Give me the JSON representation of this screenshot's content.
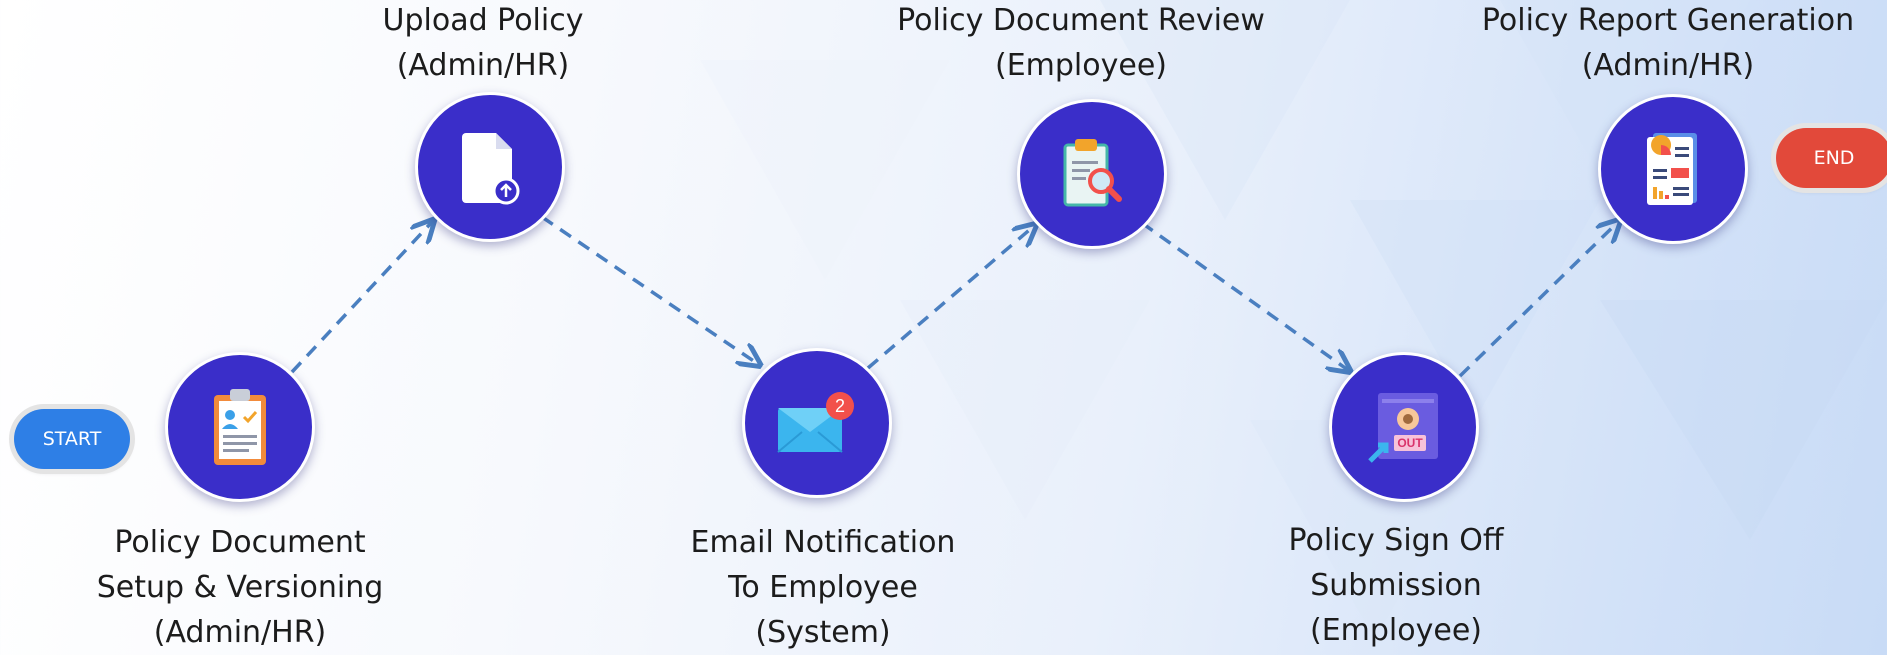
{
  "start_label": "START",
  "end_label": "END",
  "steps": [
    {
      "lines": [
        "Policy Document",
        "Setup & Versioning",
        "(Admin/HR)"
      ],
      "icon": "clipboard-checklist-icon"
    },
    {
      "lines": [
        "Upload Policy",
        "(Admin/HR)"
      ],
      "icon": "document-upload-icon"
    },
    {
      "lines": [
        "Email Notification",
        "To Employee",
        "(System)"
      ],
      "icon": "email-notification-icon",
      "badge": "2"
    },
    {
      "lines": [
        "Policy Document Review",
        "(Employee)"
      ],
      "icon": "clipboard-search-icon"
    },
    {
      "lines": [
        "Policy Sign Off",
        "Submission",
        "(Employee)"
      ],
      "icon": "sign-off-out-icon",
      "badge_text": "OUT"
    },
    {
      "lines": [
        "Policy Report Generation",
        "(Admin/HR)"
      ],
      "icon": "report-document-icon"
    }
  ],
  "colors": {
    "node": "#3a2ec9",
    "connector": "#4a7fc0",
    "start": "#2e7fe6",
    "end": "#e2493a"
  }
}
